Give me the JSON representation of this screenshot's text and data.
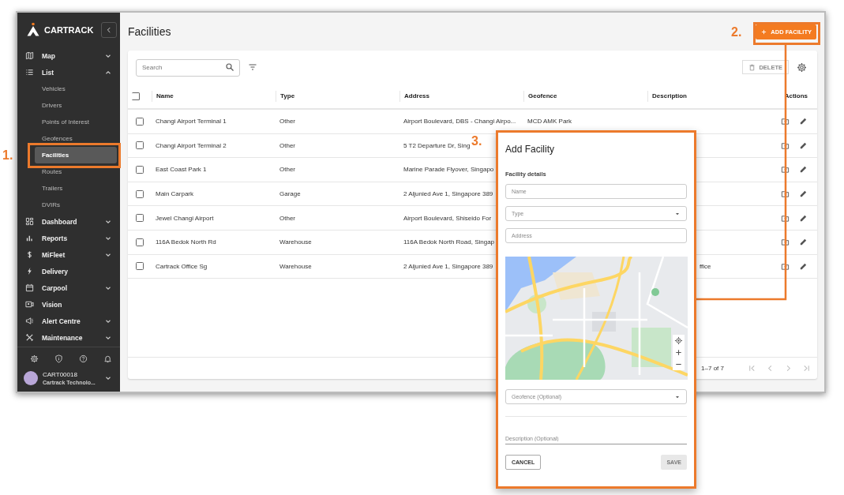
{
  "sidebar": {
    "logo": "CARTRACK",
    "items": [
      {
        "label": "Map",
        "kind": "group",
        "expanded": false
      },
      {
        "label": "List",
        "kind": "group",
        "expanded": true,
        "children": [
          {
            "label": "Vehicles",
            "selected": false
          },
          {
            "label": "Drivers",
            "selected": false
          },
          {
            "label": "Points of Interest",
            "selected": false
          },
          {
            "label": "Geofences",
            "selected": false
          },
          {
            "label": "Facilities",
            "selected": true
          },
          {
            "label": "Routes",
            "selected": false
          },
          {
            "label": "Trailers",
            "selected": false
          },
          {
            "label": "DVIRs",
            "selected": false
          }
        ]
      },
      {
        "label": "Dashboard",
        "kind": "group",
        "expanded": false
      },
      {
        "label": "Reports",
        "kind": "group",
        "expanded": false
      },
      {
        "label": "MiFleet",
        "kind": "group",
        "expanded": false
      },
      {
        "label": "Delivery",
        "kind": "link"
      },
      {
        "label": "Carpool",
        "kind": "group",
        "expanded": false
      },
      {
        "label": "Vision",
        "kind": "link"
      },
      {
        "label": "Alert Centre",
        "kind": "group",
        "expanded": false
      },
      {
        "label": "Maintenance",
        "kind": "group",
        "expanded": false
      }
    ],
    "user": {
      "name": "CART00018",
      "company": "Cartrack Technolo..."
    }
  },
  "page": {
    "title": "Facilities",
    "add_button": "ADD FACILITY"
  },
  "toolbar": {
    "search": {
      "placeholder": "Search"
    },
    "delete_button": {
      "label": "DELETE",
      "disabled": true
    }
  },
  "table": {
    "select_all_checked": false,
    "columns": [
      "Name",
      "Type",
      "Address",
      "Geofence",
      "Description",
      "Actions"
    ],
    "rows": [
      {
        "checked": false,
        "name": "Changi Airport Terminal 1",
        "type": "Other",
        "address": "Airport Boulevard, DBS - Changi Airpo...",
        "geofence": "MCD AMK Park"
      },
      {
        "checked": false,
        "name": "Changi Airport Terminal 2",
        "type": "Other",
        "address": "5 T2 Departure Dr, Sing"
      },
      {
        "checked": false,
        "name": "East Coast Park 1",
        "type": "Other",
        "address": "Marine Parade Flyover, Singapo"
      },
      {
        "checked": false,
        "name": "Main Carpark",
        "type": "Garage",
        "address": "2 Aljunied Ave 1, Singapore 389"
      },
      {
        "checked": false,
        "name": "Jewel Changi Airport",
        "type": "Other",
        "address": "Airport Boulevard, Shiseido For"
      },
      {
        "checked": false,
        "name": "116A Bedok North Rd",
        "type": "Warehouse",
        "address": "116A Bedok North Road, Singap"
      },
      {
        "checked": false,
        "name": "Cartrack Office Sg",
        "type": "Warehouse",
        "address": "2 Aljunied Ave 1, Singapore 389",
        "description": "ffice"
      }
    ]
  },
  "pagination": {
    "range": "1–7 of 7",
    "buttons": [
      {
        "kind": "first",
        "disabled": true
      },
      {
        "kind": "previous",
        "disabled": true
      },
      {
        "kind": "next",
        "disabled": true
      },
      {
        "kind": "last",
        "disabled": true
      }
    ]
  },
  "dialog": {
    "title": "Add Facility",
    "section": "Facility details",
    "fields": [
      {
        "kind": "text",
        "placeholder": "Name"
      },
      {
        "kind": "select",
        "placeholder": "Type"
      },
      {
        "kind": "text",
        "placeholder": "Address"
      },
      {
        "kind": "map"
      },
      {
        "kind": "select",
        "placeholder": "Geofence (Optional)"
      },
      {
        "kind": "underline",
        "placeholder": "Description (Optional)"
      }
    ],
    "buttons": [
      {
        "label": "CANCEL",
        "disabled": false
      },
      {
        "label": "SAVE",
        "disabled": true
      }
    ]
  },
  "annotations": [
    {
      "label": "1."
    },
    {
      "label": "2."
    },
    {
      "label": "3."
    }
  ]
}
